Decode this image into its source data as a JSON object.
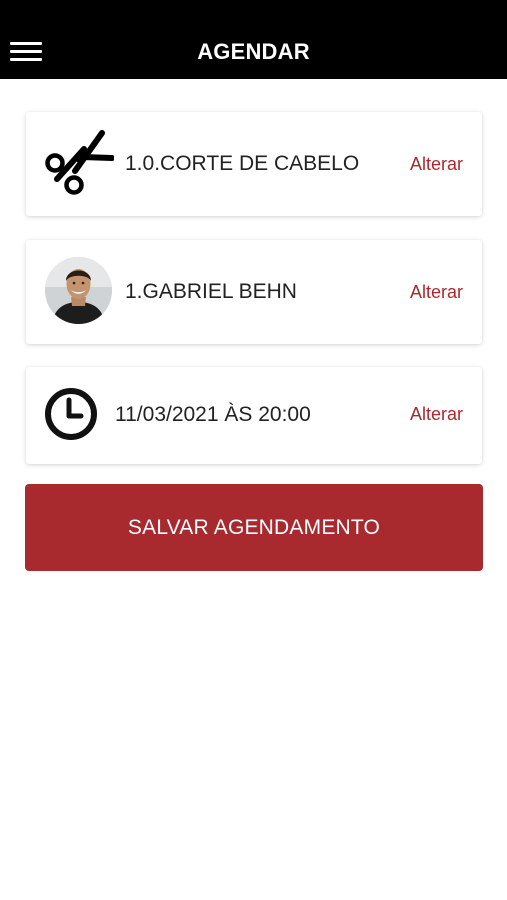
{
  "header": {
    "title": "AGENDAR",
    "menu_icon": "hamburger-menu-icon",
    "background": "#000000"
  },
  "service": {
    "icon": "scissors-icon",
    "label": "1.0.CORTE DE CABELO",
    "action": "Alterar"
  },
  "barber": {
    "avatar": "barber-avatar",
    "label": "1.GABRIEL BEHN",
    "action": "Alterar"
  },
  "datetime": {
    "icon": "clock-icon",
    "label": "11/03/2021 ÀS 20:00",
    "action": "Alterar"
  },
  "save_button": {
    "label": "SALVAR AGENDAMENTO"
  },
  "colors": {
    "accent": "#a8292e",
    "text": "#222222"
  }
}
